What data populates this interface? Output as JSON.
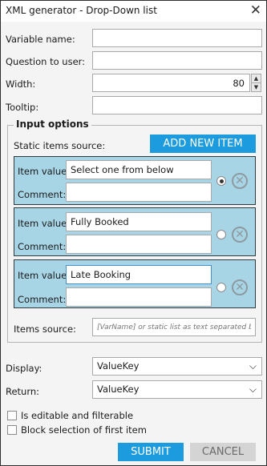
{
  "window": {
    "title": "XML generator - Drop-Down list",
    "close_glyph": "✕"
  },
  "fields": {
    "variable_name": {
      "label": "Variable name:",
      "value": ""
    },
    "question": {
      "label": "Question to user:",
      "value": ""
    },
    "width": {
      "label": "Width:",
      "value": "80"
    },
    "tooltip": {
      "label": "Tooltip:",
      "value": ""
    }
  },
  "input_options": {
    "legend": "Input options",
    "static_source_label": "Static items source:",
    "add_button": "ADD NEW ITEM",
    "item_value_label": "Item value:",
    "comment_label": "Comment:",
    "items": [
      {
        "value": "Select one from below",
        "comment": "",
        "selected": true
      },
      {
        "value": "Fully Booked",
        "comment": "",
        "selected": false
      },
      {
        "value": "Late Booking",
        "comment": "",
        "selected": false
      }
    ],
    "items_source_label": "Items source:",
    "items_source_placeholder": "[VarName] or static list as text separated by ';'"
  },
  "display": {
    "label": "Display:",
    "value": "ValueKey"
  },
  "return": {
    "label": "Return:",
    "value": "ValueKey"
  },
  "checkboxes": {
    "editable": {
      "label": "Is editable and filterable",
      "checked": false
    },
    "block_first": {
      "label": "Block selection of first item",
      "checked": false
    }
  },
  "buttons": {
    "submit": "SUBMIT",
    "cancel": "CANCEL"
  },
  "colors": {
    "accent": "#1c9bde",
    "item_panel": "#a8d5e6"
  }
}
